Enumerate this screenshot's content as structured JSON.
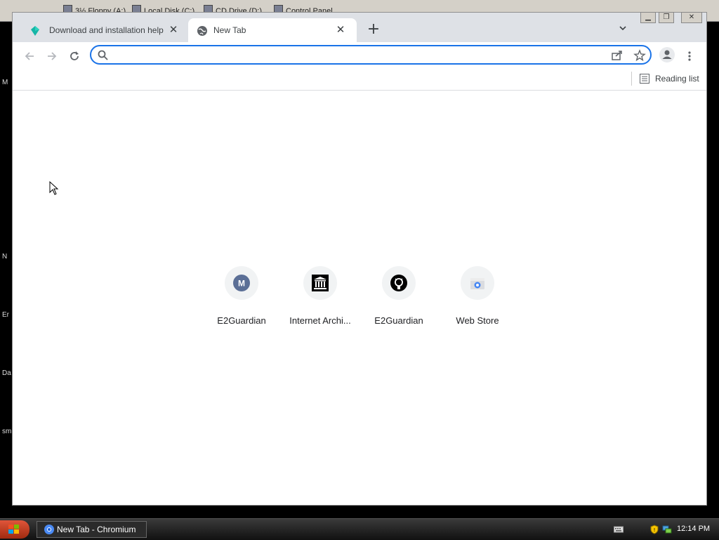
{
  "desktop": {
    "drives": [
      "3½ Floppy (A:)",
      "Local Disk (C:)",
      "CD Drive (D:)",
      "Control Panel"
    ],
    "side_labels": [
      "M",
      "N",
      "Er",
      "Da",
      "sm"
    ]
  },
  "browser": {
    "tabs": [
      {
        "title": "Download and installation help",
        "active": false
      },
      {
        "title": "New Tab",
        "active": true
      }
    ],
    "new_tab_symbol": "+",
    "omnibox": {
      "value": "",
      "placeholder": ""
    },
    "reading_list_label": "Reading list",
    "shortcuts": [
      {
        "label": "E2Guardian",
        "icon": "m-letter-icon",
        "letter": "M"
      },
      {
        "label": "Internet Archi...",
        "icon": "archive-icon"
      },
      {
        "label": "E2Guardian",
        "icon": "github-icon"
      },
      {
        "label": "Web Store",
        "icon": "webstore-icon"
      }
    ]
  },
  "taskbar": {
    "task_label": "New Tab - Chromium",
    "clock": "12:14 PM"
  },
  "colors": {
    "accent": "#1a73e8",
    "tabstrip": "#dee1e6"
  }
}
